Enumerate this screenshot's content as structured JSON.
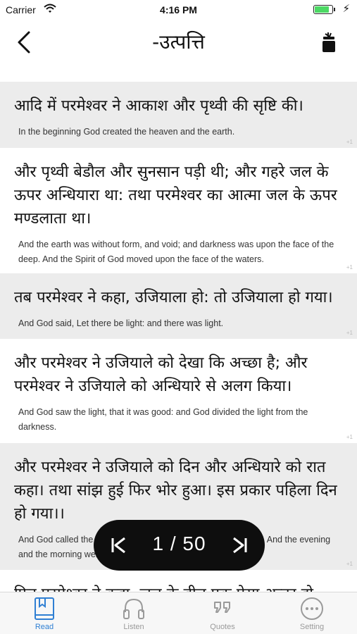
{
  "status_bar": {
    "carrier": "Carrier",
    "time": "4:16 PM",
    "battery_level": 0.85,
    "charging_icon": "bolt-icon"
  },
  "nav": {
    "title": "-उत्पत्ति",
    "back_icon": "chevron-left-icon",
    "right_icon": "cup-icon"
  },
  "verses": [
    {
      "hindi": "आदि में परमेश्वर ने आकाश और पृथ्वी की सृष्टि की।",
      "english": "In the beginning God created the heaven and the earth.",
      "num": "+1"
    },
    {
      "hindi": "और पृथ्वी बेडौल और सुनसान पड़ी थी; और गहरे जल के ऊपर अन्धियारा था: तथा परमेश्वर का आत्मा जल के ऊपर मण्डलाता था।",
      "english": "And the earth was without form, and void; and darkness was upon the face of the deep. And the Spirit of God moved upon the face of the waters.",
      "num": "+1"
    },
    {
      "hindi": "तब परमेश्वर ने कहा, उजियाला हो: तो उजियाला हो गया।",
      "english": "And God said, Let there be light: and there was light.",
      "num": "+1"
    },
    {
      "hindi": "और परमेश्वर ने उजियाले को देखा कि अच्छा है; और परमेश्वर ने उजियाले को अन्धियारे से अलग किया।",
      "english": "And God saw the light, that it was good: and God divided the light from the darkness.",
      "num": "+1"
    },
    {
      "hindi": "और परमेश्वर ने उजियाले को दिन और अन्धियारे को रात कहा। तथा सांझ हुई फिर भोर हुआ। इस प्रकार पहिला दिन हो गया।।",
      "english": "And God called the light Day, and the darkness he called Night. And the evening and the morning were the first day.",
      "num": "+1"
    },
    {
      "hindi": "फिर परमेश्वर ने कहा, जल के बीच एक ऐसा अन्तर हो",
      "english": "",
      "num": ""
    }
  ],
  "pager": {
    "label": "1 / 50",
    "current": 1,
    "total": 50,
    "prev_icon": "skip-previous-icon",
    "next_icon": "skip-next-icon"
  },
  "tabs": [
    {
      "label": "Read",
      "icon": "book-icon",
      "active": true
    },
    {
      "label": "Listen",
      "icon": "headphones-icon",
      "active": false
    },
    {
      "label": "Quotes",
      "icon": "quote-icon",
      "active": false
    },
    {
      "label": "Setting",
      "icon": "more-icon",
      "active": false
    }
  ],
  "colors": {
    "accent": "#2f7fd3",
    "inactive": "#9a9a9a",
    "verse_shade": "#ececec",
    "pager_bg": "#0e0e0e",
    "battery": "#4cd964"
  }
}
